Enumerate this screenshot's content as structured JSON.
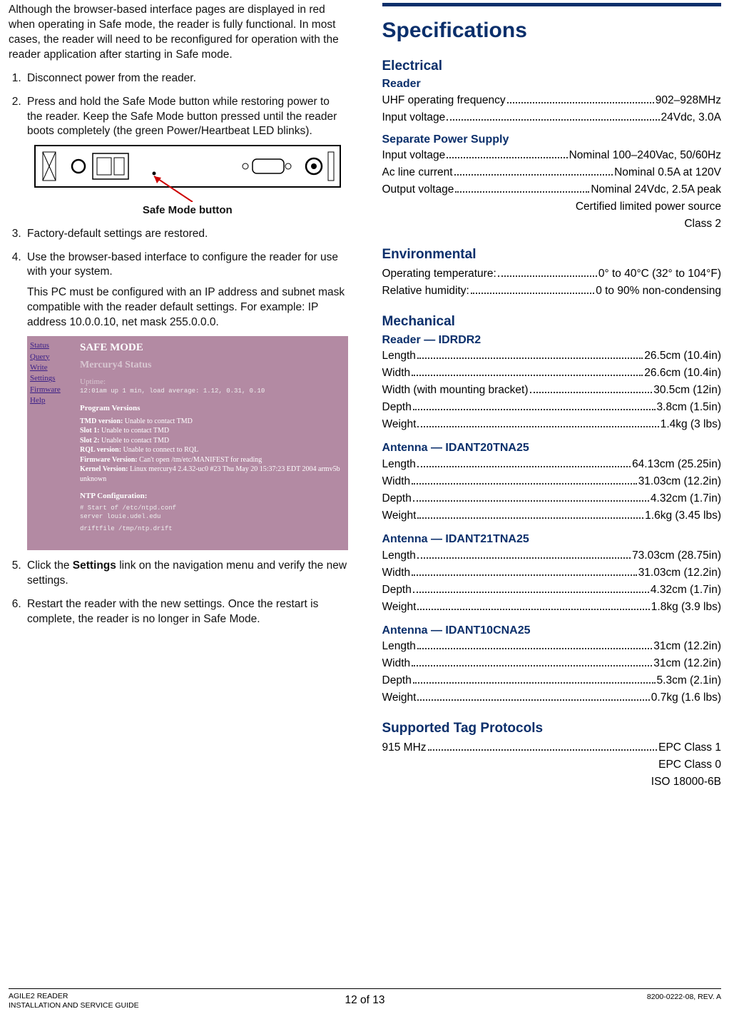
{
  "left": {
    "intro": "Although the browser-based interface pages are displayed in red when operating in Safe mode, the reader is fully functional. In most cases, the reader will need to be reconfigured for operation with the reader application after starting in Safe mode.",
    "step1": "Disconnect power from the reader.",
    "step2": "Press and hold the Safe Mode button while restoring power to the reader. Keep the Safe Mode button pressed until the reader boots completely (the green Power/Heartbeat LED blinks).",
    "figCaption": "Safe Mode button",
    "step3": "Factory-default settings are restored.",
    "step4": "Use the browser-based interface to configure the reader for use with your system.",
    "step4b": "This PC must be configured with an IP address and subnet mask compatible with the reader default settings. For example: IP address 10.0.0.10, net mask 255.0.0.0.",
    "step5_pre": "Click the ",
    "step5_bold": "Settings",
    "step5_post": " link on the navigation menu and verify the new settings.",
    "step6": "Restart the reader with the new settings. Once the restart is complete, the reader is no longer in Safe Mode.",
    "safeModeShot": {
      "nav": [
        "Status",
        "Query",
        "Write",
        "Settings",
        "Firmware",
        "Help"
      ],
      "h1": "SAFE MODE",
      "h2": "Mercury4 Status",
      "uptimeLabel": "Uptime:",
      "uptimeLine": " 12:01am  up 1 min, load average: 1.12, 0.31, 0.10",
      "progHdr": "Program Versions",
      "lines": [
        [
          "TMD version:",
          "Unable to contact TMD"
        ],
        [
          "Slot 1:",
          "Unable to contact TMD"
        ],
        [
          "Slot 2:",
          "Unable to contact TMD"
        ],
        [
          "RQL version:",
          "Unable to connect to RQL"
        ],
        [
          "Firmware Version:",
          "Can't open /tm/etc/MANIFEST for reading"
        ],
        [
          "Kernel Version:",
          "Linux mercury4 2.4.32-uc0 #23 Thu May 20 15:37:23 EDT 2004 armv5b unknown"
        ]
      ],
      "ntpHdr": "NTP Configuration:",
      "ntp1": "# Start of /etc/ntpd.conf",
      "ntp2": "server louie.udel.edu",
      "ntp3": "driftfile /tmp/ntp.drift"
    }
  },
  "right": {
    "specsTitle": "Specifications",
    "electrical": {
      "title": "Electrical",
      "reader": {
        "title": "Reader",
        "rows": [
          [
            "UHF operating frequency",
            "902–928MHz"
          ],
          [
            "Input voltage",
            "24Vdc, 3.0A"
          ]
        ]
      },
      "sps": {
        "title": "Separate Power Supply",
        "rows": [
          [
            "Input voltage",
            "Nominal 100–240Vac, 50/60Hz"
          ],
          [
            "Ac line current",
            "Nominal 0.5A at 120V"
          ],
          [
            "Output voltage",
            "Nominal 24Vdc, 2.5A peak"
          ]
        ],
        "extra": [
          "Certified limited power source",
          "Class 2"
        ]
      }
    },
    "environmental": {
      "title": "Environmental",
      "rows": [
        [
          "Operating temperature:",
          "0° to 40°C (32° to 104°F)"
        ],
        [
          "Relative humidity:",
          "0 to 90% non-condensing"
        ]
      ]
    },
    "mechanical": {
      "title": "Mechanical",
      "groups": [
        {
          "title": "Reader — IDRDR2",
          "rows": [
            [
              "Length",
              "26.5cm (10.4in)"
            ],
            [
              "Width",
              "26.6cm (10.4in)"
            ],
            [
              "Width (with mounting bracket)",
              "30.5cm (12in)"
            ],
            [
              "Depth",
              "3.8cm (1.5in)"
            ],
            [
              "Weight",
              "1.4kg (3 lbs)"
            ]
          ]
        },
        {
          "title": "Antenna — IDANT20TNA25",
          "rows": [
            [
              "Length",
              "64.13cm (25.25in)"
            ],
            [
              "Width",
              "31.03cm (12.2in)"
            ],
            [
              "Depth",
              "4.32cm (1.7in)"
            ],
            [
              "Weight",
              "1.6kg (3.45 lbs)"
            ]
          ]
        },
        {
          "title": "Antenna — IDANT21TNA25",
          "rows": [
            [
              "Length",
              "73.03cm (28.75in)"
            ],
            [
              "Width",
              "31.03cm (12.2in)"
            ],
            [
              "Depth",
              "4.32cm (1.7in)"
            ],
            [
              "Weight",
              "1.8kg (3.9 lbs)"
            ]
          ]
        },
        {
          "title": "Antenna — IDANT10CNA25",
          "rows": [
            [
              "Length",
              "31cm (12.2in)"
            ],
            [
              "Width",
              "31cm (12.2in)"
            ],
            [
              "Depth",
              "5.3cm (2.1in)"
            ],
            [
              "Weight",
              "0.7kg (1.6 lbs)"
            ]
          ]
        }
      ]
    },
    "protocols": {
      "title": "Supported Tag Protocols",
      "row": [
        "915 MHz",
        "EPC Class 1"
      ],
      "extra": [
        "EPC Class 0",
        "ISO 18000-6B"
      ]
    }
  },
  "footer": {
    "left1": "AGILE2 READER",
    "left2": "INSTALLATION AND SERVICE GUIDE",
    "center": "12 of 13",
    "right": "8200-0222-08, REV. A"
  }
}
